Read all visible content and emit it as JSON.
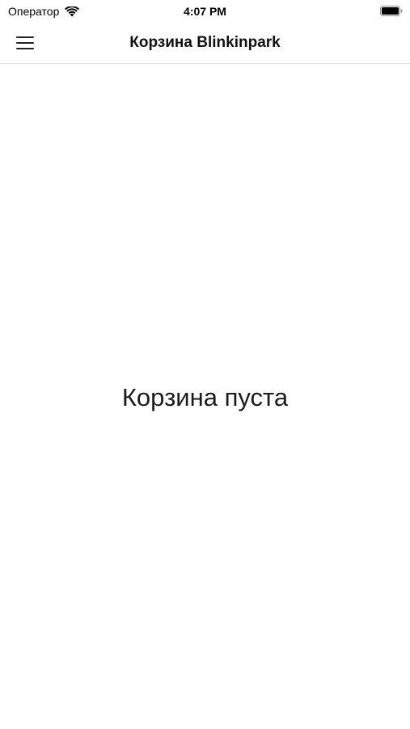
{
  "status_bar": {
    "carrier": "Оператор",
    "time": "4:07 PM",
    "wifi_icon": "wifi-icon",
    "battery_icon": "battery-icon"
  },
  "nav_bar": {
    "title": "Корзина Blinkinpark",
    "menu_icon": "hamburger-menu-icon"
  },
  "content": {
    "empty_message": "Корзина пуста"
  }
}
